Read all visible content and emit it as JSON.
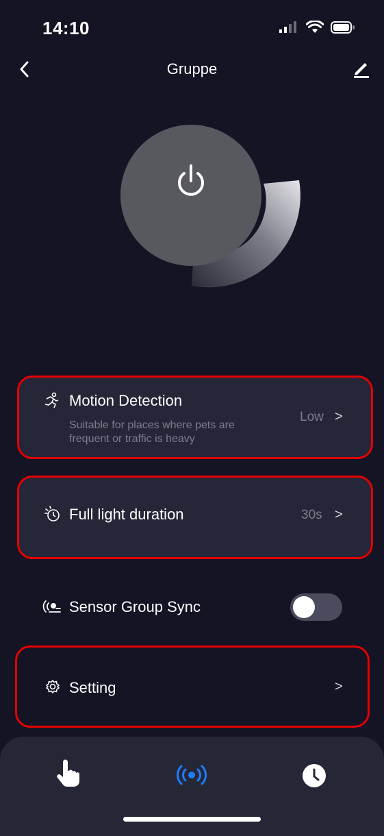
{
  "status_bar": {
    "time": "14:10"
  },
  "nav": {
    "title": "Gruppe",
    "back_icon": "chevron-left-icon",
    "edit_icon": "pencil-icon"
  },
  "power_dial": {
    "icon": "power-icon",
    "level": 0.25
  },
  "motion_detection": {
    "title": "Motion Detection",
    "description_line1": "Suitable for places where pets are",
    "description_line2": "frequent or traffic is heavy",
    "value": "Low",
    "chevron": ">"
  },
  "full_light": {
    "title": "Full light duration",
    "value": "30s",
    "chevron": ">"
  },
  "sensor_sync": {
    "title": "Sensor Group Sync",
    "enabled": false
  },
  "setting": {
    "title": "Setting",
    "chevron": ">"
  },
  "tabs": [
    {
      "icon": "hand-tap-icon",
      "active": false
    },
    {
      "icon": "radar-signal-icon",
      "active": true
    },
    {
      "icon": "clock-icon",
      "active": false
    }
  ],
  "colors": {
    "background": "#141424",
    "card": "#252637",
    "accent": "#1f7cff",
    "highlight": "#e60000"
  }
}
